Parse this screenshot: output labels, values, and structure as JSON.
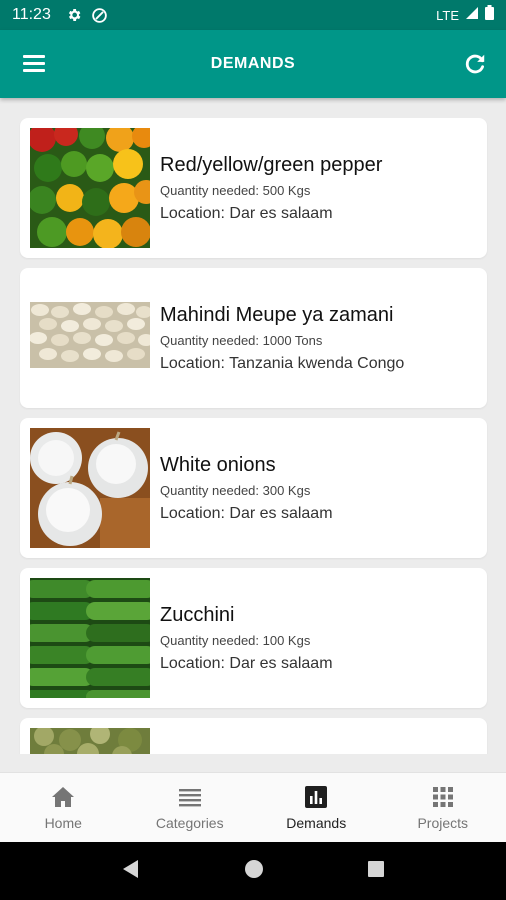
{
  "status_bar": {
    "time": "11:23",
    "network": "LTE"
  },
  "app_bar": {
    "title": "DEMANDS"
  },
  "demands": [
    {
      "name": "Red/yellow/green pepper",
      "quantity": "Quantity needed: 500 Kgs",
      "location": "Location: Dar es salaam",
      "image": "peppers"
    },
    {
      "name": "Mahindi Meupe ya zamani",
      "quantity": "Quantity needed: 1000 Tons",
      "location": "Location: Tanzania kwenda Congo",
      "image": "white-maize"
    },
    {
      "name": "White onions",
      "quantity": "Quantity needed: 300 Kgs",
      "location": "Location: Dar es salaam",
      "image": "onions"
    },
    {
      "name": "Zucchini",
      "quantity": "Quantity needed: 100 Kgs",
      "location": "Location: Dar es salaam",
      "image": "zucchini"
    }
  ],
  "bottom_nav": [
    {
      "label": "Home",
      "icon": "home-icon",
      "active": false
    },
    {
      "label": "Categories",
      "icon": "list-icon",
      "active": false
    },
    {
      "label": "Demands",
      "icon": "bar-chart-icon",
      "active": true
    },
    {
      "label": "Projects",
      "icon": "grid-icon",
      "active": false
    }
  ],
  "colors": {
    "status_bar": "#00796b",
    "app_bar": "#009688",
    "background": "#ececec"
  }
}
